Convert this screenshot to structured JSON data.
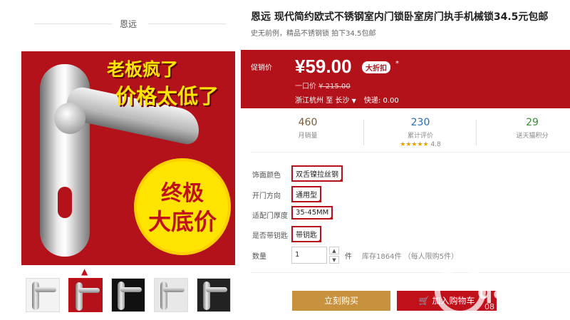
{
  "shop": {
    "name": "恩远"
  },
  "banner": {
    "line1": "老板疯了",
    "line2": "价格太低了",
    "circle1": "终极",
    "circle2": "大底价"
  },
  "product": {
    "title": "恩远 现代简约欧式不锈钢室内门锁卧室房门执手机械锁34.5元包邮",
    "subtitle": "史无前例，精品不锈钢锁 拍下34.5包邮"
  },
  "promo": {
    "label": "促销价",
    "price": "¥59.00",
    "badge": "大折扣",
    "star": "*",
    "orig_label": "一口价",
    "orig_price": "¥ 215.00",
    "shipping_from": "浙江杭州",
    "shipping_to_word": "至",
    "shipping_dest": "长沙",
    "shipping_fee": "快递: 0.00"
  },
  "stats": [
    {
      "num": "460",
      "label": "月销量",
      "color": "#7a5a3a"
    },
    {
      "num": "230",
      "label": "累计评价",
      "color": "#2a6db5",
      "stars": "★★★★★",
      "rating": "4.8"
    },
    {
      "num": "29",
      "label": "送天猫积分",
      "color": "#3a8a3a"
    }
  ],
  "options": [
    {
      "label": "饰面颜色",
      "value": "双舌镍拉丝钢"
    },
    {
      "label": "开门方向",
      "value": "通用型"
    },
    {
      "label": "适配门厚度",
      "value": "35-45MM"
    },
    {
      "label": "是否带钥匙",
      "value": "带钥匙"
    }
  ],
  "quantity": {
    "label": "数量",
    "value": "1",
    "unit": "件",
    "stock": "库存1864件 （每人限购5件）"
  },
  "actions": {
    "buy": "立刻购买",
    "cart": "加入购物车"
  },
  "watermark": {
    "text": "q8 搜家",
    "url": "08"
  },
  "colors": {
    "brand_red": "#b3121a",
    "buy_gold": "#c7913e"
  },
  "icons": {
    "cart": "cart-icon",
    "caret": "caret-up-icon"
  }
}
